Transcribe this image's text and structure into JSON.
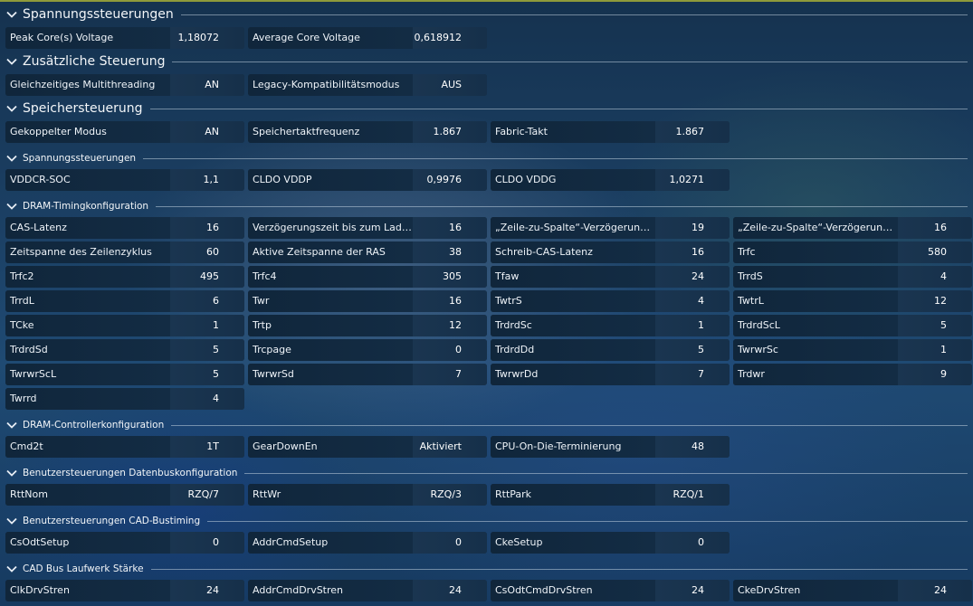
{
  "sections": [
    {
      "id": "voltage",
      "title": "Spannungssteuerungen",
      "level": "major",
      "rows": [
        [
          {
            "label": "Peak Core(s) Voltage",
            "value": "1,18072"
          },
          {
            "label": "Average Core Voltage",
            "value": "0,618912"
          }
        ]
      ]
    },
    {
      "id": "additional",
      "title": "Zusätzliche Steuerung",
      "level": "major",
      "rows": [
        [
          {
            "label": "Gleichzeitiges Multithreading",
            "value": "AN"
          },
          {
            "label": "Legacy-Kompatibilitätsmodus",
            "value": "AUS"
          }
        ]
      ]
    },
    {
      "id": "memory",
      "title": "Speichersteuerung",
      "level": "major",
      "rows": [
        [
          {
            "label": "Gekoppelter Modus",
            "value": "AN"
          },
          {
            "label": "Speichertaktfrequenz",
            "value": "1.867"
          },
          {
            "label": "Fabric-Takt",
            "value": "1.867"
          }
        ]
      ]
    },
    {
      "id": "mem-voltage",
      "title": "Spannungssteuerungen",
      "level": "minor",
      "rows": [
        [
          {
            "label": "VDDCR-SOC",
            "value": "1,1"
          },
          {
            "label": "CLDO VDDP",
            "value": "0,9976"
          },
          {
            "label": "CLDO VDDG",
            "value": "1,0271"
          }
        ]
      ]
    },
    {
      "id": "dram-timing",
      "title": "DRAM-Timingkonfiguration",
      "level": "minor",
      "rows": [
        [
          {
            "label": "CAS-Latenz",
            "value": "16"
          },
          {
            "label": "Verzögerungszeit bis zum Laden d...",
            "value": "16"
          },
          {
            "label": "„Zeile-zu-Spalte“-Verzögerungszeit...",
            "value": "19"
          },
          {
            "label": "„Zeile-zu-Spalte“-Verzögerungszeit...",
            "value": "16"
          }
        ],
        [
          {
            "label": "Zeitspanne des Zeilenzyklus",
            "value": "60"
          },
          {
            "label": "Aktive Zeitspanne der RAS",
            "value": "38"
          },
          {
            "label": "Schreib-CAS-Latenz",
            "value": "16"
          },
          {
            "label": "Trfc",
            "value": "580"
          }
        ],
        [
          {
            "label": "Trfc2",
            "value": "495"
          },
          {
            "label": "Trfc4",
            "value": "305"
          },
          {
            "label": "Tfaw",
            "value": "24"
          },
          {
            "label": "TrrdS",
            "value": "4"
          }
        ],
        [
          {
            "label": "TrrdL",
            "value": "6"
          },
          {
            "label": "Twr",
            "value": "16"
          },
          {
            "label": "TwtrS",
            "value": "4"
          },
          {
            "label": "TwtrL",
            "value": "12"
          }
        ],
        [
          {
            "label": "TCke",
            "value": "1"
          },
          {
            "label": "Trtp",
            "value": "12"
          },
          {
            "label": "TrdrdSc",
            "value": "1"
          },
          {
            "label": "TrdrdScL",
            "value": "5"
          }
        ],
        [
          {
            "label": "TrdrdSd",
            "value": "5"
          },
          {
            "label": "Trcpage",
            "value": "0"
          },
          {
            "label": "TrdrdDd",
            "value": "5"
          },
          {
            "label": "TwrwrSc",
            "value": "1"
          }
        ],
        [
          {
            "label": "TwrwrScL",
            "value": "5"
          },
          {
            "label": "TwrwrSd",
            "value": "7"
          },
          {
            "label": "TwrwrDd",
            "value": "7"
          },
          {
            "label": "Trdwr",
            "value": "9"
          }
        ],
        [
          {
            "label": "Twrrd",
            "value": "4"
          }
        ]
      ]
    },
    {
      "id": "dram-controller",
      "title": "DRAM-Controllerkonfiguration",
      "level": "minor",
      "rows": [
        [
          {
            "label": "Cmd2t",
            "value": "1T"
          },
          {
            "label": "GearDownEn",
            "value": "Aktiviert"
          },
          {
            "label": "CPU-On-Die-Terminierung",
            "value": "48"
          }
        ]
      ]
    },
    {
      "id": "databus",
      "title": "Benutzersteuerungen Datenbuskonfiguration",
      "level": "minor",
      "rows": [
        [
          {
            "label": "RttNom",
            "value": "RZQ/7"
          },
          {
            "label": "RttWr",
            "value": "RZQ/3"
          },
          {
            "label": "RttPark",
            "value": "RZQ/1"
          }
        ]
      ]
    },
    {
      "id": "cad-timing",
      "title": "Benutzersteuerungen CAD-Bustiming",
      "level": "minor",
      "rows": [
        [
          {
            "label": "CsOdtSetup",
            "value": "0"
          },
          {
            "label": "AddrCmdSetup",
            "value": "0"
          },
          {
            "label": "CkeSetup",
            "value": "0"
          }
        ]
      ]
    },
    {
      "id": "cad-drive",
      "title": "CAD Bus Laufwerk Stärke",
      "level": "minor",
      "rows": [
        [
          {
            "label": "ClkDrvStren",
            "value": "24"
          },
          {
            "label": "AddrCmdDrvStren",
            "value": "24"
          },
          {
            "label": "CsOdtCmdDrvStren",
            "value": "24"
          },
          {
            "label": "CkeDrvStren",
            "value": "24"
          }
        ]
      ]
    }
  ]
}
